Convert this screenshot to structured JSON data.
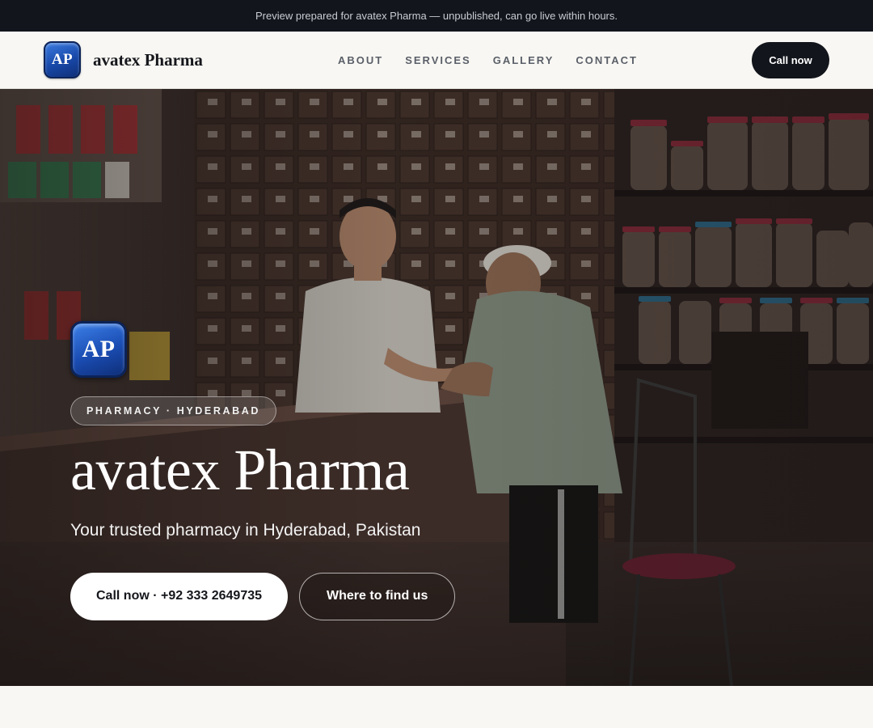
{
  "banner": {
    "text": "Preview prepared for avatex Pharma — unpublished, can go live within hours."
  },
  "header": {
    "logo_text": "AP",
    "brand_name": "avatex Pharma",
    "nav": [
      {
        "label": "ABOUT"
      },
      {
        "label": "SERVICES"
      },
      {
        "label": "GALLERY"
      },
      {
        "label": "CONTACT"
      }
    ],
    "call_label": "Call now"
  },
  "hero": {
    "logo_text": "AP",
    "tag": "PHARMACY · HYDERABAD",
    "title": "avatex Pharma",
    "subtitle": "Your trusted pharmacy in Hyderabad, Pakistan",
    "primary_button": "Call now · +92 333 2649735",
    "secondary_button": "Where to find us"
  },
  "colors": {
    "dark": "#12151b",
    "logo_blue": "#1848a8",
    "page_bg": "#f8f7f3"
  }
}
